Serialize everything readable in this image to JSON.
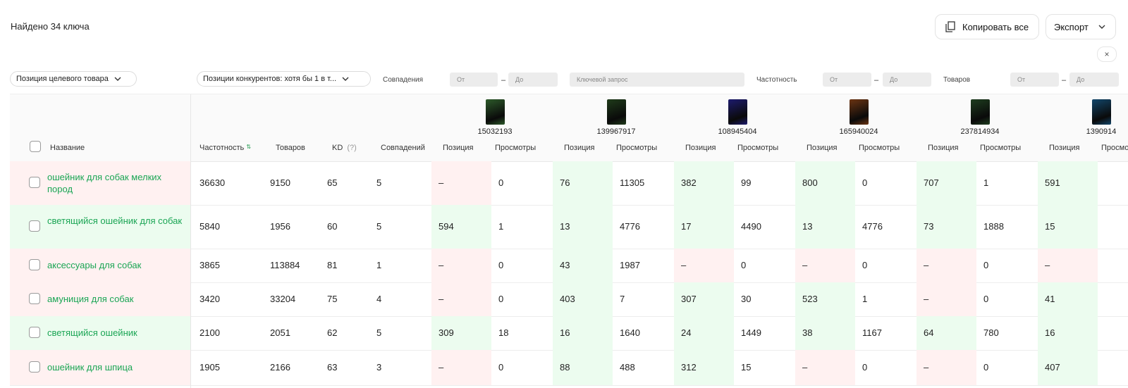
{
  "header": {
    "found_text": "Найдено 34 ключа",
    "copy_all_label": "Копировать все",
    "export_label": "Экспорт",
    "close_glyph": "×"
  },
  "filters": {
    "target_position_label": "Позиция целевого товара",
    "competitors_label": "Позиции конкурентов: хотя бы 1 в т...",
    "matches_label": "Совпадения",
    "frequency_label": "Частотность",
    "products_label": "Товаров",
    "from_placeholder": "От",
    "to_placeholder": "До",
    "keyword_placeholder": "Ключевой запрос",
    "dash": "–"
  },
  "table": {
    "col_name": "Название",
    "col_frequency": "Частотность",
    "col_products": "Товаров",
    "col_kd": "KD",
    "col_kd_hint": "(?)",
    "col_matches": "Совпадений",
    "col_position": "Позиция",
    "col_views": "Просмотры",
    "products": [
      {
        "id": "15032193",
        "thumb_color": "#2d5a2a"
      },
      {
        "id": "139967917",
        "thumb_color": "#1f3b1a"
      },
      {
        "id": "108945404",
        "thumb_color": "#1d1b6e"
      },
      {
        "id": "165940024",
        "thumb_color": "#6b3412"
      },
      {
        "id": "237814934",
        "thumb_color": "#1e3d1f"
      },
      {
        "id": "1390914",
        "thumb_color": "#12466a"
      }
    ],
    "rows": [
      {
        "keyword": "ошейник для собак мелких пород",
        "frequency": "36630",
        "products": "9150",
        "kd": "65",
        "matches": "5",
        "status": "red",
        "cells": [
          [
            "–",
            "0",
            "red"
          ],
          [
            "76",
            "11305",
            "green"
          ],
          [
            "382",
            "99",
            "green"
          ],
          [
            "800",
            "0",
            "green"
          ],
          [
            "707",
            "1",
            "green"
          ],
          [
            "591",
            "",
            "green"
          ]
        ]
      },
      {
        "keyword": "светящийся ошейник для собак",
        "frequency": "5840",
        "products": "1956",
        "kd": "60",
        "matches": "5",
        "status": "green",
        "cells": [
          [
            "594",
            "1",
            "green"
          ],
          [
            "13",
            "4776",
            "green"
          ],
          [
            "17",
            "4490",
            "green"
          ],
          [
            "13",
            "4776",
            "green"
          ],
          [
            "73",
            "1888",
            "green"
          ],
          [
            "15",
            "",
            "green"
          ]
        ]
      },
      {
        "keyword": "аксессуары для собак",
        "frequency": "3865",
        "products": "113884",
        "kd": "81",
        "matches": "1",
        "status": "red",
        "cells": [
          [
            "–",
            "0",
            "red"
          ],
          [
            "43",
            "1987",
            "green"
          ],
          [
            "–",
            "0",
            "red"
          ],
          [
            "–",
            "0",
            "red"
          ],
          [
            "–",
            "0",
            "red"
          ],
          [
            "–",
            "",
            "red"
          ]
        ]
      },
      {
        "keyword": "амуниция для собак",
        "frequency": "3420",
        "products": "33204",
        "kd": "75",
        "matches": "4",
        "status": "red",
        "cells": [
          [
            "–",
            "0",
            "red"
          ],
          [
            "403",
            "7",
            "green"
          ],
          [
            "307",
            "30",
            "green"
          ],
          [
            "523",
            "1",
            "green"
          ],
          [
            "–",
            "0",
            "red"
          ],
          [
            "41",
            "",
            "green"
          ]
        ]
      },
      {
        "keyword": "светящийся ошейник",
        "frequency": "2100",
        "products": "2051",
        "kd": "62",
        "matches": "5",
        "status": "green",
        "cells": [
          [
            "309",
            "18",
            "green"
          ],
          [
            "16",
            "1640",
            "green"
          ],
          [
            "24",
            "1449",
            "green"
          ],
          [
            "38",
            "1167",
            "green"
          ],
          [
            "64",
            "780",
            "green"
          ],
          [
            "16",
            "",
            "green"
          ]
        ]
      },
      {
        "keyword": "ошейник для шпица",
        "frequency": "1905",
        "products": "2166",
        "kd": "63",
        "matches": "3",
        "status": "red",
        "cells": [
          [
            "–",
            "0",
            "red"
          ],
          [
            "88",
            "488",
            "green"
          ],
          [
            "312",
            "15",
            "green"
          ],
          [
            "–",
            "0",
            "red"
          ],
          [
            "–",
            "0",
            "red"
          ],
          [
            "407",
            "",
            "green"
          ]
        ]
      }
    ]
  }
}
